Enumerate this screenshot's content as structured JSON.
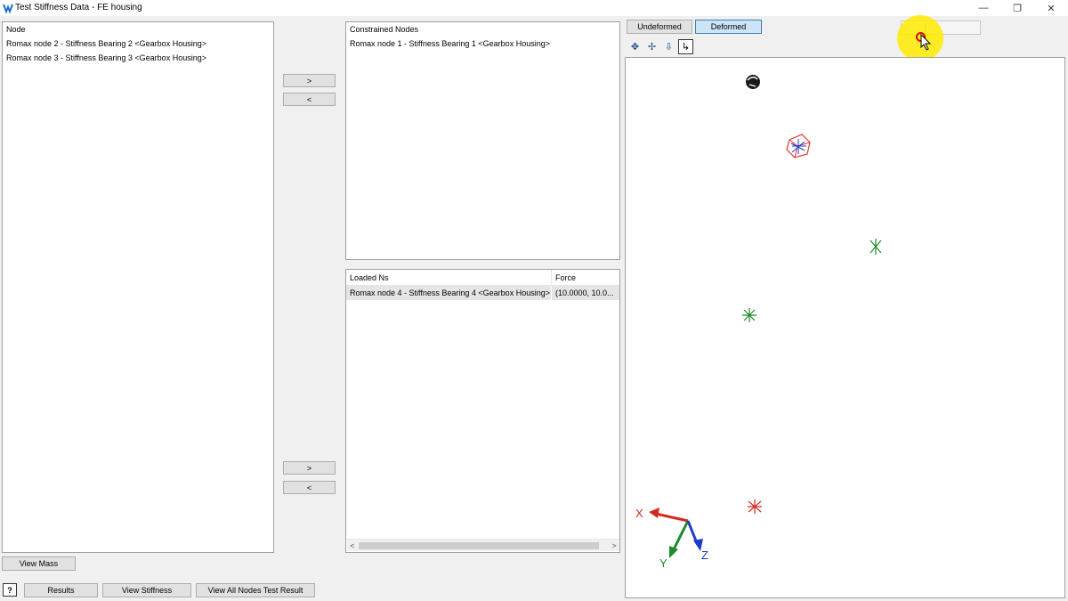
{
  "window": {
    "title": "Test Stiffness Data - FE housing",
    "minimize_glyph": "—",
    "restore_glyph": "❐",
    "close_glyph": "✕"
  },
  "node_list": {
    "header": "Node",
    "items": [
      "Romax node 2 - Stiffness Bearing 2 <Gearbox Housing>",
      "Romax node 3 - Stiffness Bearing 3 <Gearbox Housing>"
    ]
  },
  "constrained": {
    "header": "Constrained Nodes",
    "items": [
      "Romax node 1 - Stiffness Bearing 1 <Gearbox Housing>"
    ],
    "add_label": ">",
    "remove_label": "<"
  },
  "loaded": {
    "columns": [
      "Loaded Ns",
      "Force"
    ],
    "rows": [
      {
        "node": "Romax node 4 - Stiffness Bearing 4 <Gearbox Housing>",
        "force": "(10.0000, 10.0..."
      }
    ],
    "add_label": ">",
    "remove_label": "<",
    "scroll_left": "<",
    "scroll_right": ">"
  },
  "bottom_buttons": {
    "view_mass": "View Mass",
    "help": "?",
    "results": "Results",
    "view_stiffness": "View Stiffness",
    "view_all": "View All Nodes Test Result"
  },
  "view_tabs": {
    "undeformed": "Undeformed",
    "deformed": "Deformed",
    "active": "Deformed"
  },
  "toolbar": {
    "icons": [
      "rotate-icon",
      "pan-icon",
      "zoom-icon",
      "select-icon"
    ],
    "glyphs": [
      "✥",
      "✢",
      "⇩",
      "↳"
    ]
  },
  "axes": {
    "x_label": "X",
    "y_label": "Y",
    "z_label": "Z",
    "x_color": "#d42a1e",
    "y_color": "#1e8a2a",
    "z_color": "#1e3cc8"
  },
  "colors": {
    "selected_tab": "#cce4f7",
    "selected_tab_border": "#3c7fb1",
    "highlight": "#ffeb00"
  }
}
